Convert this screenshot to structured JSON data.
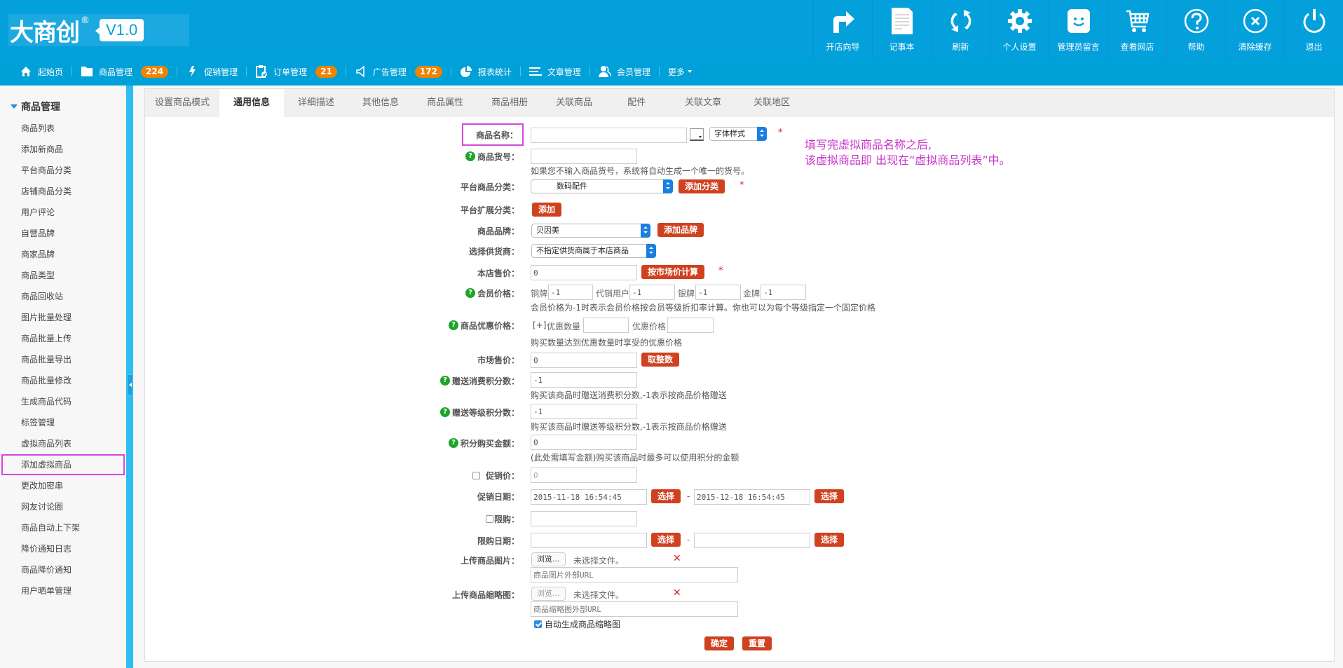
{
  "header": {
    "logo_text": "大商创",
    "logo_reg": "®",
    "version": "V1.0",
    "tools": [
      {
        "label": "开店向导",
        "icon": "arrow-turn-right-icon"
      },
      {
        "label": "记事本",
        "icon": "notepad-icon"
      },
      {
        "label": "刷新",
        "icon": "refresh-icon"
      },
      {
        "label": "个人设置",
        "icon": "gear-icon"
      },
      {
        "label": "管理员留言",
        "icon": "smiley-message-icon"
      },
      {
        "label": "查看网店",
        "icon": "shopping-cart-icon"
      },
      {
        "label": "帮助",
        "icon": "help-circle-icon"
      },
      {
        "label": "清除缓存",
        "icon": "clear-cache-icon"
      },
      {
        "label": "退出",
        "icon": "power-icon"
      }
    ]
  },
  "nav": {
    "items": [
      {
        "label": "起始页",
        "icon": "home-icon"
      },
      {
        "label": "商品管理",
        "icon": "folder-icon",
        "badge": "224"
      },
      {
        "label": "促销管理",
        "icon": "lightning-icon"
      },
      {
        "label": "订单管理",
        "icon": "clipboard-check-icon",
        "badge": "21"
      },
      {
        "label": "广告管理",
        "icon": "megaphone-icon",
        "badge": "172"
      },
      {
        "label": "报表统计",
        "icon": "pie-chart-icon"
      },
      {
        "label": "文章管理",
        "icon": "list-icon"
      },
      {
        "label": "会员管理",
        "icon": "users-icon"
      }
    ],
    "more_label": "更多"
  },
  "sidebar": {
    "group_title": "商品管理",
    "items": [
      "商品列表",
      "添加新商品",
      "平台商品分类",
      "店铺商品分类",
      "用户评论",
      "自营品牌",
      "商家品牌",
      "商品类型",
      "商品回收站",
      "图片批量处理",
      "商品批量上传",
      "商品批量导出",
      "商品批量修改",
      "生成商品代码",
      "标签管理",
      "虚拟商品列表",
      "添加虚拟商品",
      "更改加密串",
      "网友讨论圈",
      "商品自动上下架",
      "降价通知日志",
      "商品降价通知",
      "用户晒单管理"
    ],
    "highlighted_index": 16
  },
  "tabs": {
    "items": [
      "设置商品模式",
      "通用信息",
      "详细描述",
      "其他信息",
      "商品属性",
      "商品相册",
      "关联商品",
      "配件",
      "关联文章",
      "关联地区"
    ],
    "active_index": 1
  },
  "annotation": {
    "line1": "填写完虚拟商品名称之后,",
    "line2": "该虚拟商品即 出现在“虚拟商品列表”中。",
    "color": "#c935c9"
  },
  "form": {
    "name": {
      "label": "商品名称：",
      "value": "",
      "font_style_select": "字体样式"
    },
    "sku": {
      "label": "商品货号：",
      "value": "",
      "hint": "如果您不输入商品货号，系统将自动生成一个唯一的货号。"
    },
    "platform_category": {
      "label": "平台商品分类：",
      "selected": "数码配件",
      "button": "添加分类"
    },
    "ext_category": {
      "label": "平台扩展分类：",
      "button": "添加"
    },
    "brand": {
      "label": "商品品牌：",
      "selected": "贝因美",
      "button": "添加品牌"
    },
    "supplier": {
      "label": "选择供货商：",
      "selected": "不指定供货商属于本店商品"
    },
    "shop_price": {
      "label": "本店售价：",
      "value": "0",
      "button": "按市场价计算"
    },
    "member_price": {
      "label": "会员价格：",
      "levels": [
        {
          "name": "铜牌",
          "value": "-1"
        },
        {
          "name": "代销用户",
          "value": "-1"
        },
        {
          "name": "银牌",
          "value": "-1"
        },
        {
          "name": "金牌",
          "value": "-1"
        }
      ],
      "hint": "会员价格为-1时表示会员价格按会员等级折扣率计算。你也可以为每个等级指定一个固定价格"
    },
    "volume_price": {
      "label": "商品优惠价格：",
      "add": "[+]",
      "qty_label": "优惠数量",
      "qty_value": "",
      "price_label": "优惠价格",
      "price_value": "",
      "hint": "购买数量达到优惠数量时享受的优惠价格"
    },
    "market_price": {
      "label": "市场售价：",
      "value": "0",
      "button": "取整数"
    },
    "give_integral": {
      "label": "赠送消费积分数：",
      "value": "-1",
      "hint": "购买该商品时赠送消费积分数,-1表示按商品价格赠送"
    },
    "rank_integral": {
      "label": "赠送等级积分数：",
      "value": "-1",
      "hint": "购买该商品时赠送等级积分数,-1表示按商品价格赠送"
    },
    "integral": {
      "label": "积分购买金额：",
      "value": "0",
      "hint": "(此处需填写金额)购买该商品时最多可以使用积分的金额"
    },
    "promote_price": {
      "label": "促销价：",
      "value": "0",
      "checked": false
    },
    "promote_date": {
      "label": "促销日期：",
      "start": "2015-11-18 16:54:45",
      "end": "2015-12-18 16:54:45",
      "button": "选择",
      "dash": "-"
    },
    "limit_buy": {
      "label": "限购：",
      "value": "",
      "checked": false
    },
    "limit_date": {
      "label": "限购日期：",
      "start": "",
      "end": "",
      "button": "选择",
      "dash": "-"
    },
    "goods_img": {
      "label": "上传商品图片：",
      "browse": "浏览...",
      "no_file": "未选择文件。",
      "url_placeholder": "商品图片外部URL"
    },
    "goods_thumb": {
      "label": "上传商品缩略图：",
      "browse": "浏览...",
      "no_file": "未选择文件。",
      "url_placeholder": "商品缩略图外部URL",
      "auto_label": "自动生成商品缩略图",
      "auto_checked": true
    },
    "required_mark": "*",
    "delete_mark": "✕",
    "submit": "确定",
    "reset": "重置"
  }
}
